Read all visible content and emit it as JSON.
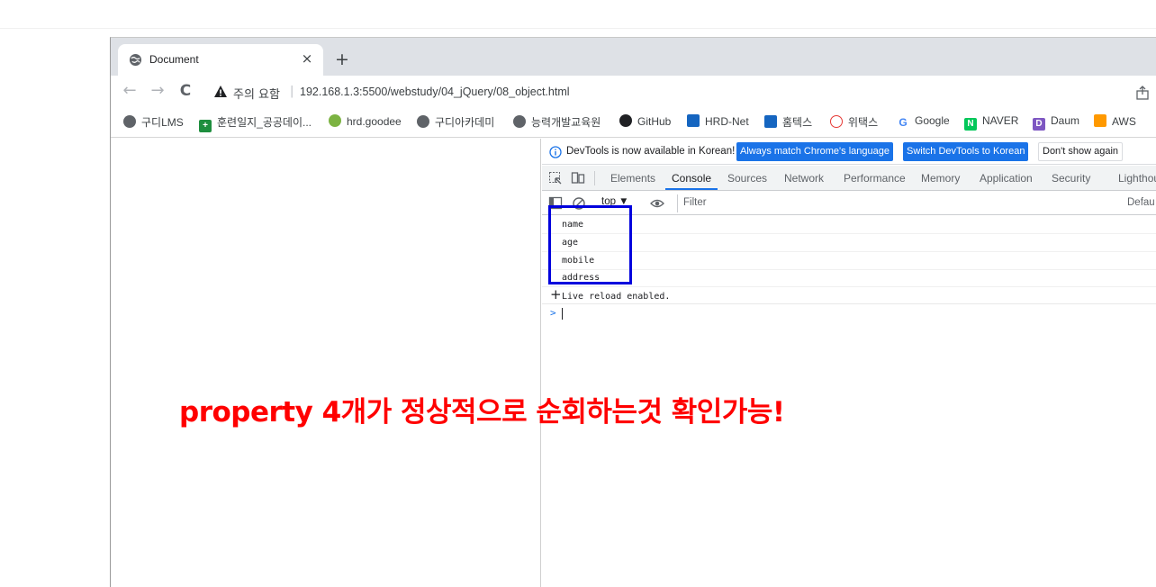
{
  "browser": {
    "tab": {
      "title": "Document",
      "close_glyph": "×"
    },
    "new_tab_glyph": "+",
    "nav": {
      "back": "←",
      "forward": "→",
      "reload": "C"
    },
    "address": {
      "security_text": "주의 요함",
      "separator": "|",
      "url": "192.168.1.3:5500/webstudy/04_jQuery/08_object.html"
    },
    "bookmarks": [
      {
        "label": "구디LMS",
        "icon": "globe-icon",
        "color": "#5f6368"
      },
      {
        "label": "훈련일지_공공데이...",
        "icon": "plus-icon",
        "color": "#1e8e3e"
      },
      {
        "label": "hrd.goodee",
        "icon": "leaf-icon",
        "color": "#7cb342"
      },
      {
        "label": "구디아카데미",
        "icon": "globe-icon",
        "color": "#5f6368"
      },
      {
        "label": "능력개발교육원",
        "icon": "globe-icon",
        "color": "#5f6368"
      },
      {
        "label": "GitHub",
        "icon": "github-icon",
        "color": "#202124"
      },
      {
        "label": "HRD-Net",
        "icon": "hrdnet-icon",
        "color": "#1565c0"
      },
      {
        "label": "홈텍스",
        "icon": "hometax-icon",
        "color": "#1565c0"
      },
      {
        "label": "위택스",
        "icon": "wetax-icon",
        "color": "#e53935"
      },
      {
        "label": "Google",
        "icon": "google-icon",
        "color": "#4285f4"
      },
      {
        "label": "NAVER",
        "icon": "naver-icon",
        "color": "#03c75a"
      },
      {
        "label": "Daum",
        "icon": "daum-icon",
        "color": "#7e57c2"
      },
      {
        "label": "AWS",
        "icon": "aws-icon",
        "color": "#ff9900"
      }
    ]
  },
  "devtools": {
    "infobar": {
      "message": "DevTools is now available in Korean!",
      "btn_match": "Always match Chrome's language",
      "btn_switch": "Switch DevTools to Korean",
      "btn_dismiss": "Don't show again"
    },
    "tabs": [
      {
        "label": "Elements",
        "active": false
      },
      {
        "label": "Console",
        "active": true
      },
      {
        "label": "Sources",
        "active": false
      },
      {
        "label": "Network",
        "active": false
      },
      {
        "label": "Performance",
        "active": false
      },
      {
        "label": "Memory",
        "active": false
      },
      {
        "label": "Application",
        "active": false
      },
      {
        "label": "Security",
        "active": false
      },
      {
        "label": "Lighthou",
        "active": false
      }
    ],
    "console_toolbar": {
      "context": "top ▼",
      "filter_placeholder": "Filter",
      "levels": "Defau"
    },
    "log_lines": [
      "name",
      "age",
      "mobile",
      "address"
    ],
    "live_reload": "Live reload enabled.",
    "live_plus": "+",
    "prompt": ">"
  },
  "annotation": {
    "text": "property 4개가 정상적으로 순회하는것 확인가능!",
    "color": "#ff0000"
  },
  "highlight": {
    "color": "#0000dd"
  }
}
